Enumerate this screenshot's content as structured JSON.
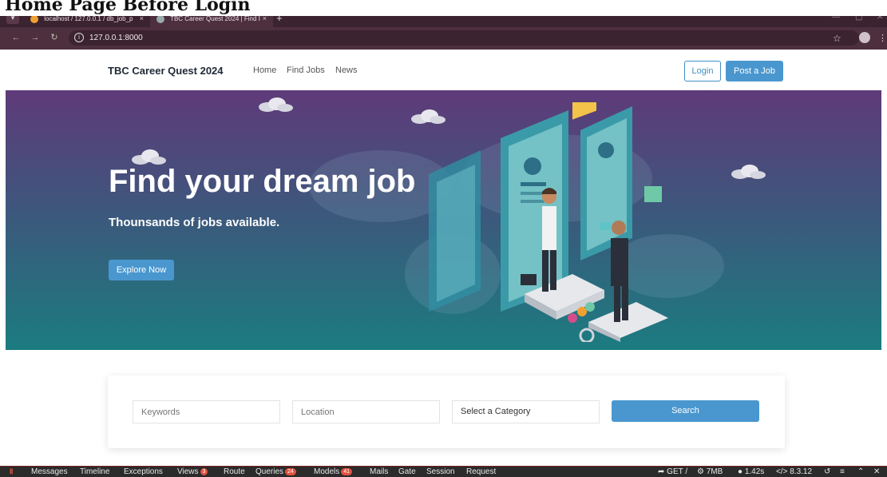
{
  "document_title": "Home Page Before Login",
  "browser": {
    "tabs": [
      {
        "title": "localhost / 127.0.0.1 / db_job_p",
        "close": "×"
      },
      {
        "title": "TBC Career Quest 2024 | Find Ⅰ",
        "close": "×"
      }
    ],
    "new_tab": "+",
    "url": "127.0.0.1:8000"
  },
  "site": {
    "brand": "TBC Career Quest 2024",
    "nav": [
      {
        "label": "Home"
      },
      {
        "label": "Find Jobs"
      },
      {
        "label": "News"
      }
    ],
    "login_label": "Login",
    "post_job_label": "Post a Job"
  },
  "hero": {
    "title": "Find your dream job",
    "subtitle": "Thounsands of jobs available.",
    "cta": "Explore Now"
  },
  "search": {
    "keywords_placeholder": "Keywords",
    "location_placeholder": "Location",
    "category_selected": "Select a Category",
    "button": "Search"
  },
  "debugbar": {
    "items": [
      {
        "label": "Messages"
      },
      {
        "label": "Timeline"
      },
      {
        "label": "Exceptions"
      },
      {
        "label": "Views",
        "badge": "3"
      },
      {
        "label": "Route"
      },
      {
        "label": "Queries",
        "badge": "24"
      },
      {
        "label": "Models",
        "badge": "41"
      },
      {
        "label": "Mails"
      },
      {
        "label": "Gate"
      },
      {
        "label": "Session"
      },
      {
        "label": "Request"
      }
    ],
    "method": "GET /",
    "memory": "7MB",
    "time": "1.42s",
    "php_version": "8.3.12"
  },
  "colors": {
    "accent": "#4a97cf",
    "hero_top": "#5f3a79",
    "hero_bottom": "#1b7c80",
    "debug_accent": "#e0523e"
  }
}
